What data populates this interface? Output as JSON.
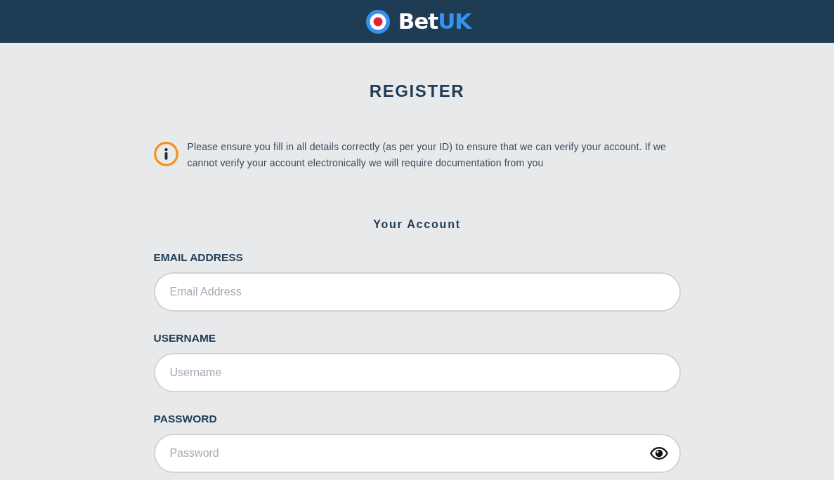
{
  "header": {
    "logo": {
      "parts": [
        {
          "text": "Bet",
          "kind": "plain"
        },
        {
          "text": "UK",
          "kind": "accent"
        }
      ]
    }
  },
  "page": {
    "title": "REGISTER",
    "notice": "Please ensure you fill in all details correctly (as per your ID) to ensure that we can verify your account. If we cannot verify your account electronically we will require documentation from you"
  },
  "section": {
    "title": "Your Account",
    "fields": [
      {
        "label": "EMAIL ADDRESS",
        "placeholder": "Email Address",
        "kind": "text"
      },
      {
        "label": "USERNAME",
        "placeholder": "Username",
        "kind": "text"
      },
      {
        "label": "PASSWORD",
        "placeholder": "Password",
        "kind": "password"
      }
    ]
  }
}
